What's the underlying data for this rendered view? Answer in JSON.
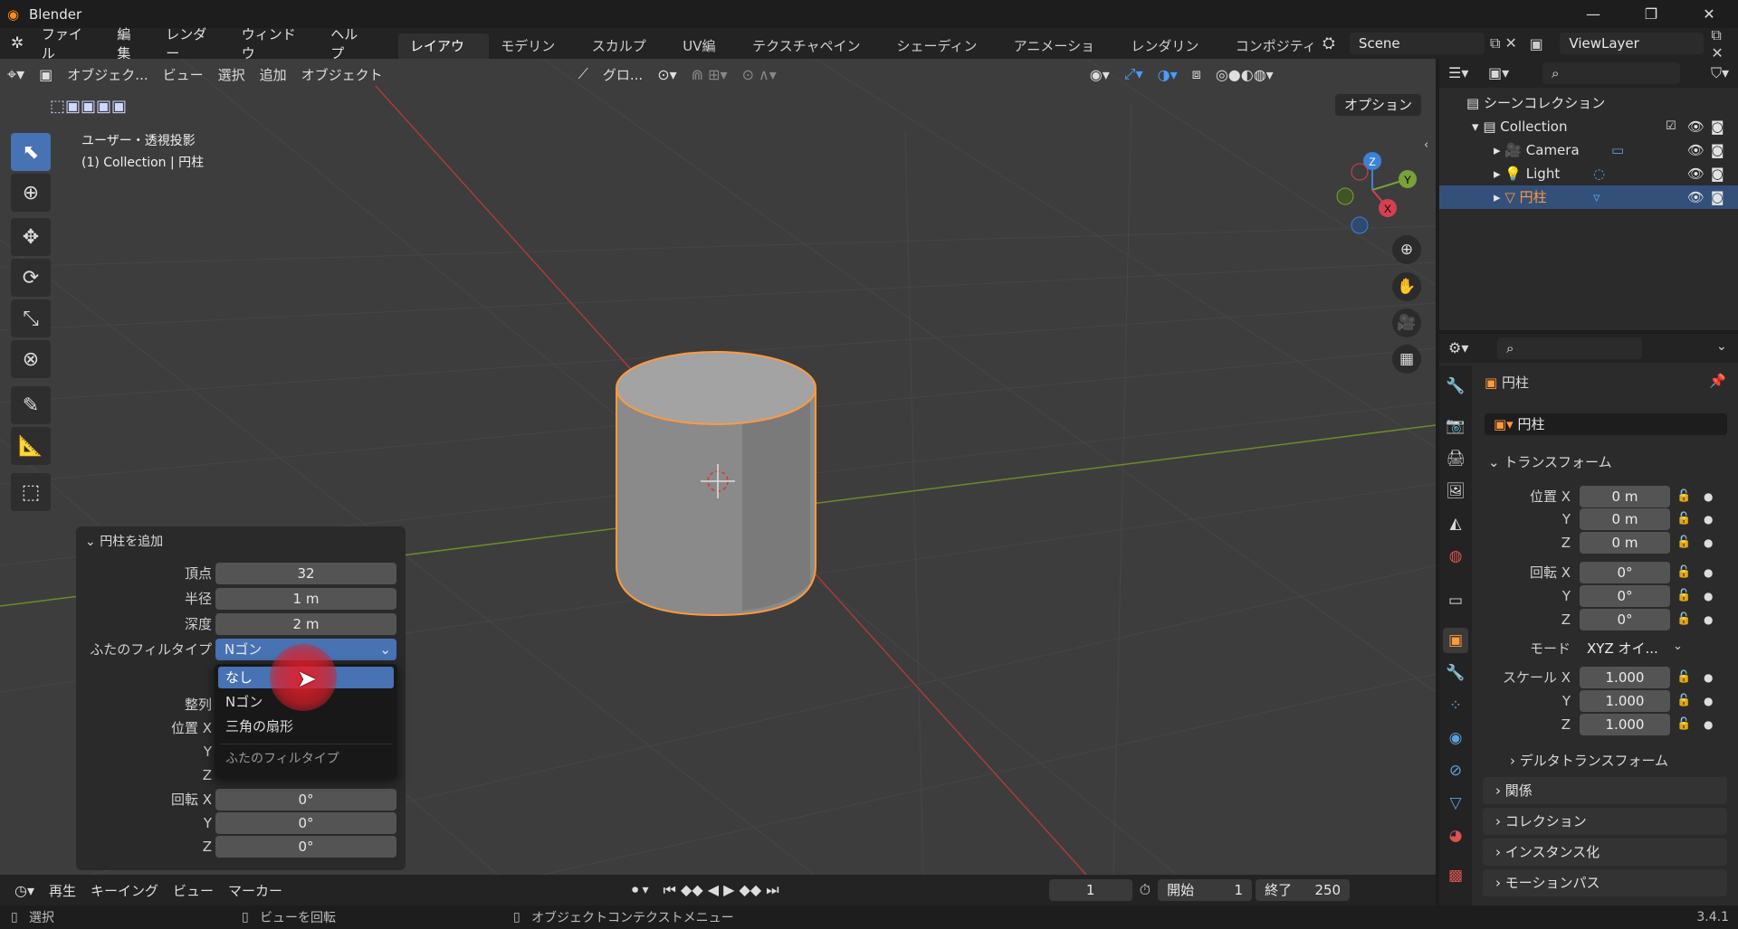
{
  "window": {
    "title": "Blender",
    "minimize": "—",
    "maximize": "❐",
    "close": "✕"
  },
  "menubar": {
    "items": [
      "ファイル",
      "編集",
      "レンダー",
      "ウィンドウ",
      "ヘルプ"
    ],
    "workspaces": [
      "レイアウト",
      "モデリング",
      "スカルプト",
      "UV編集",
      "テクスチャペイント",
      "シェーディング",
      "アニメーション",
      "レンダリング",
      "コンポジティン"
    ],
    "scene": "Scene",
    "viewlayer": "ViewLayer"
  },
  "viewport": {
    "header": {
      "mode": "オブジェク...",
      "menus": [
        "ビュー",
        "選択",
        "追加",
        "オブジェクト"
      ],
      "transform": "グロ...",
      "options": "オプション"
    },
    "overlay_title": "ユーザー・透視投影",
    "overlay_subtitle": "(1) Collection | 円柱",
    "gizmo": {
      "z": "Z",
      "y": "Y",
      "x": "X"
    }
  },
  "operator_panel": {
    "title": "円柱を追加",
    "fields": [
      {
        "label": "頂点",
        "value": "32"
      },
      {
        "label": "半径",
        "value": "1 m"
      },
      {
        "label": "深度",
        "value": "2 m"
      }
    ],
    "fill_label": "ふたのフィルタイプ",
    "fill_value": "Nゴン",
    "align_label": "整列",
    "loc_labels": [
      "位置 X",
      "Y",
      "Z"
    ],
    "rot_labels": [
      "回転 X",
      "Y",
      "Z"
    ],
    "rot_values": [
      "0°",
      "0°",
      "0°"
    ]
  },
  "dropdown": {
    "options": [
      "なし",
      "Nゴン",
      "三角の扇形"
    ],
    "selected": "なし",
    "caption": "ふたのフィルタイプ"
  },
  "timeline": {
    "menus": [
      "再生",
      "キーイング",
      "ビュー",
      "マーカー"
    ],
    "current_frame": "1",
    "start_label": "開始",
    "start": "1",
    "end_label": "終了",
    "end": "250"
  },
  "statusbar": {
    "select": "選択",
    "rotate": "ビューを回転",
    "context": "オブジェクトコンテクストメニュー",
    "version": "3.4.1"
  },
  "outliner": {
    "root": "シーンコレクション",
    "collection": "Collection",
    "items": [
      {
        "name": "Camera",
        "color": "#e08a3c"
      },
      {
        "name": "Light",
        "color": "#e08a3c"
      },
      {
        "name": "円柱",
        "color": "#ff9a3c"
      }
    ]
  },
  "properties": {
    "object_name": "円柱",
    "data_name": "円柱",
    "transform_title": "トランスフォーム",
    "location": {
      "labels": [
        "位置 X",
        "Y",
        "Z"
      ],
      "values": [
        "0 m",
        "0 m",
        "0 m"
      ]
    },
    "rotation": {
      "labels": [
        "回転 X",
        "Y",
        "Z"
      ],
      "values": [
        "0°",
        "0°",
        "0°"
      ]
    },
    "mode_label": "モード",
    "mode_value": "XYZ オイ...",
    "scale": {
      "labels": [
        "スケール X",
        "Y",
        "Z"
      ],
      "values": [
        "1.000",
        "1.000",
        "1.000"
      ]
    },
    "sections": [
      "デルタトランスフォーム",
      "関係",
      "コレクション",
      "インスタンス化",
      "モーションパス"
    ]
  },
  "colors": {
    "accent": "#4772b3",
    "selection": "#ff9a3c",
    "viewport_bg": "#3d3d3d"
  }
}
